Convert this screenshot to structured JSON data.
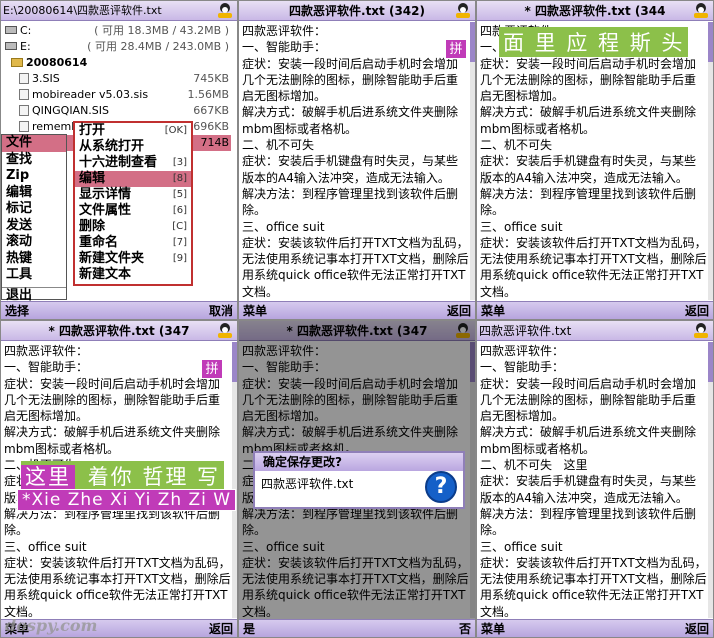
{
  "colors": {
    "accent": "#b7a5de",
    "highlight": "#d36f86",
    "ime": "#c03bb8",
    "ime_green": "#8cc04a"
  },
  "fm": {
    "title": "E:\\20080614\\四款恶评软件.txt",
    "drives": [
      {
        "name": "C:",
        "info": "( 可用 18.3MB / 43.2MB )"
      },
      {
        "name": "E:",
        "info": "( 可用 28.4MB / 243.0MB )"
      }
    ],
    "rows": [
      {
        "name": "20080614",
        "size": ""
      },
      {
        "name": "3.SIS",
        "size": "745KB"
      },
      {
        "name": "mobireader v5.03.sis",
        "size": "1.56MB"
      },
      {
        "name": "QINGQIAN.SIS",
        "size": "667KB"
      },
      {
        "name": "rememb...",
        "size": "696KB"
      },
      {
        "name": "",
        "size": "714B"
      }
    ],
    "left_menu": [
      "文件",
      "查找",
      "Zip",
      "编辑",
      "标记",
      "发送",
      "滚动",
      "热键",
      "工具",
      "退出"
    ],
    "sub_menu": [
      {
        "label": "打开",
        "key": "[OK]"
      },
      {
        "label": "从系统打开",
        "key": ""
      },
      {
        "label": "十六进制查看",
        "key": "[3]"
      },
      {
        "label": "编辑",
        "key": "[8]"
      },
      {
        "label": "显示详情",
        "key": "[5]"
      },
      {
        "label": "文件属性",
        "key": "[6]"
      },
      {
        "label": "删除",
        "key": "[C]"
      },
      {
        "label": "重命名",
        "key": "[7]"
      },
      {
        "label": "新建文件夹",
        "key": "[9]"
      },
      {
        "label": "新建文本",
        "key": ""
      }
    ],
    "sk_left": "选择",
    "sk_right": "取消"
  },
  "doc": {
    "lines": [
      "四款恶评软件：",
      "一、智能助手：",
      "症状：安装一段时间后启动手机时会增加几个无法删除的图标，删除智能助手后重启无图标增加。",
      "解决方式：破解手机后进系统文件夹删除mbm图标或者格机。",
      "二、机不可失",
      "症状：安装后手机键盘有时失灵，与某些版本的A4输入法冲突，造成无法输入。",
      "解决方法：到程序管理里找到该软件后删除。",
      "三、office suit",
      "症状：安装该软件后打开TXT文档为乱码，无法使用系统记事本打开TXT文档，删除后用系统quick office软件无法正常打开TXT文档。"
    ],
    "line5_extra": "这里"
  },
  "p2": {
    "title": "四款恶评软件.txt (342)",
    "sk_left": "菜单",
    "sk_right": "返回",
    "ime_badge": "拼"
  },
  "p3": {
    "title": "* 四款恶评软件.txt (344",
    "sk_left": "菜单",
    "sk_right": "返回",
    "candidates": "面 里 应 程 斯 头"
  },
  "p4": {
    "title": "* 四款恶评软件.txt (347",
    "sk_left": "菜单",
    "sk_right": "返回",
    "ime_badge": "拼",
    "candidates_white": "这里",
    "candidates_green": "着你 哲理 写",
    "pinyin": "*Xie Zhe Xi Yi Zh Zi W"
  },
  "p5": {
    "title": "* 四款恶评软件.txt (347",
    "dialog_title": "确定保存更改?",
    "dialog_text": "四款恶评软件.txt",
    "sk_left": "是",
    "sk_right": "否"
  },
  "p6": {
    "title": "四款恶评软件.txt",
    "sk_left": "菜单",
    "sk_right": "返回"
  },
  "watermark": "dospy.com"
}
